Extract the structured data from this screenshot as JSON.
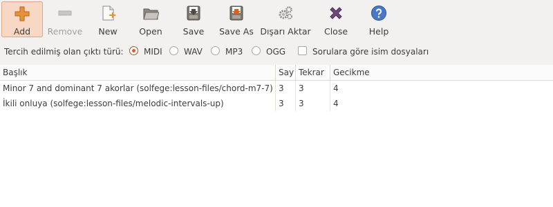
{
  "toolbar": {
    "add": "Add",
    "remove": "Remove",
    "new": "New",
    "open": "Open",
    "save": "Save",
    "save_as": "Save As",
    "export": "Dışarı Aktar",
    "close": "Close",
    "help": "Help"
  },
  "output": {
    "label": "Tercih edilmiş olan çıktı türü:",
    "options": [
      "MIDI",
      "WAV",
      "MP3",
      "OGG"
    ],
    "selected": "MIDI",
    "name_by_question_label": "Sorulara göre isim dosyaları"
  },
  "table": {
    "columns": [
      "Başlık",
      "Say",
      "Tekrar",
      "Gecikme"
    ],
    "rows": [
      [
        "Minor 7 and dominant 7 akorlar (solfege:lesson-files/chord-m7-7)",
        "3",
        "3",
        "4"
      ],
      [
        "İkili onluya (solfege:lesson-files/melodic-intervals-up)",
        "3",
        "3",
        "4"
      ]
    ]
  },
  "colors": {
    "accent": "#df5d20",
    "active_bg": "#f8d8c4"
  }
}
